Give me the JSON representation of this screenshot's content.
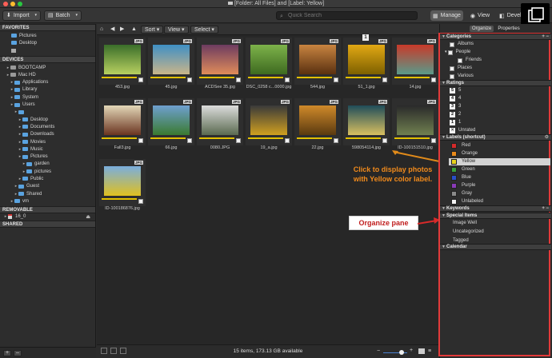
{
  "window": {
    "title": "[Folder: All Files] and [Label: Yellow]"
  },
  "toolbar": {
    "import_label": "Import",
    "batch_label": "Batch",
    "search_placeholder": "Quick Search",
    "modes": [
      {
        "label": "Manage",
        "active": true
      },
      {
        "label": "View",
        "active": false
      },
      {
        "label": "Develop",
        "active": false
      }
    ]
  },
  "left_panel": {
    "favorites_header": "FAVORITES",
    "favorites": [
      "Pictures",
      "Desktop"
    ],
    "devices_header": "DEVICES",
    "devices": [
      {
        "label": "BOOTCAMP",
        "indent": 1,
        "kind": "drive"
      },
      {
        "label": "Mac HD",
        "indent": 1,
        "kind": "drive"
      },
      {
        "label": "Applications",
        "indent": 2,
        "kind": "folder"
      },
      {
        "label": "Library",
        "indent": 2,
        "kind": "folder"
      },
      {
        "label": "System",
        "indent": 2,
        "kind": "folder"
      },
      {
        "label": "Users",
        "indent": 2,
        "kind": "folder"
      },
      {
        "label": "",
        "indent": 3,
        "kind": "folder"
      },
      {
        "label": "Desktop",
        "indent": 4,
        "kind": "folder"
      },
      {
        "label": "Documents",
        "indent": 4,
        "kind": "folder"
      },
      {
        "label": "Downloads",
        "indent": 4,
        "kind": "folder"
      },
      {
        "label": "Movies",
        "indent": 4,
        "kind": "folder"
      },
      {
        "label": "Music",
        "indent": 4,
        "kind": "folder"
      },
      {
        "label": "Pictures",
        "indent": 4,
        "kind": "folder"
      },
      {
        "label": "garden",
        "indent": 5,
        "kind": "folder"
      },
      {
        "label": "pictures",
        "indent": 5,
        "kind": "folder"
      },
      {
        "label": "Public",
        "indent": 4,
        "kind": "folder"
      },
      {
        "label": "Guest",
        "indent": 3,
        "kind": "folder"
      },
      {
        "label": "Shared",
        "indent": 3,
        "kind": "folder"
      },
      {
        "label": "vm",
        "indent": 2,
        "kind": "folder"
      }
    ],
    "removable_header": "REMOVABLE",
    "removable_item": "16_0",
    "shared_header": "SHARED",
    "add_button": "+",
    "remove_button": "–"
  },
  "browser_nav": {
    "sort_label": "Sort",
    "view_label": "View",
    "select_label": "Select"
  },
  "thumbnails": [
    {
      "name": "453.jpg",
      "badge": "JPG",
      "colors": [
        "#3a6e2a",
        "#b8d060"
      ]
    },
    {
      "name": "45.jpg",
      "badge": "JPG",
      "colors": [
        "#3f8fc4",
        "#c9b58a"
      ]
    },
    {
      "name": "ACDSee 35.jpg",
      "badge": "JPG",
      "colors": [
        "#6d3c60",
        "#e08c5a"
      ]
    },
    {
      "name": "DSC_0258 c...0000.jpg",
      "badge": "JPG",
      "colors": [
        "#7db24a",
        "#3e6a20"
      ]
    },
    {
      "name": "544.jpg",
      "badge": "JPG",
      "colors": [
        "#c88440",
        "#5a3010"
      ]
    },
    {
      "name": "51_1.jpg",
      "badge": "JPG",
      "colors": [
        "#e2a814",
        "#7d6000"
      ]
    },
    {
      "name": "14.jpg",
      "badge": "JPG",
      "colors": [
        "#c83a2a",
        "#5a9a8a"
      ]
    },
    {
      "name": "Fall3.jpg",
      "badge": "JPG",
      "colors": [
        "#e3d8b8",
        "#6a3420"
      ]
    },
    {
      "name": "66.jpg",
      "badge": "JPG",
      "colors": [
        "#6fa0d0",
        "#3a7a30"
      ]
    },
    {
      "name": "0080.JPG",
      "badge": "JPG",
      "colors": [
        "#dcdcdc",
        "#5a6a50"
      ]
    },
    {
      "name": "19_a.jpg",
      "badge": "JPG",
      "colors": [
        "#3a3a3a",
        "#d0a020"
      ]
    },
    {
      "name": "22.jpg",
      "badge": "JPG",
      "colors": [
        "#d08a2a",
        "#5a3a10"
      ]
    },
    {
      "name": "598054114.jpg",
      "badge": "JPG",
      "colors": [
        "#1f4d5a",
        "#d8c060"
      ]
    },
    {
      "name": "ID-100151510.jpg",
      "badge": "JPG",
      "colors": [
        "#2a2a2a",
        "#708050"
      ]
    },
    {
      "name": "ID-100186876.jpg",
      "badge": "JPG",
      "colors": [
        "#7aaede",
        "#e0c020"
      ]
    }
  ],
  "thumb_top_badge": "1",
  "callout_text": "Click to display photos with Yellow color label.",
  "organize_label": "Organize pane",
  "status": {
    "text": "15 items, 173.13 GB available"
  },
  "right_panel": {
    "tab_organize": "Organize",
    "tab_properties": "Properties",
    "categories_header": "Categories",
    "categories": [
      {
        "label": "Albums",
        "indent": 0
      },
      {
        "label": "People",
        "indent": 0
      },
      {
        "label": "Friends",
        "indent": 1
      },
      {
        "label": "Places",
        "indent": 0
      },
      {
        "label": "Various",
        "indent": 0
      }
    ],
    "ratings_header": "Ratings",
    "ratings": [
      {
        "num": "5",
        "label": "5"
      },
      {
        "num": "4",
        "label": "4"
      },
      {
        "num": "3",
        "label": "3"
      },
      {
        "num": "2",
        "label": "2"
      },
      {
        "num": "1",
        "label": "1"
      },
      {
        "num": "",
        "label": "Unrated"
      }
    ],
    "labels_header": "Labels (shortcut)",
    "labels": [
      {
        "label": "Red",
        "color": "#d42a2a"
      },
      {
        "label": "Orange",
        "color": "#e88a1a"
      },
      {
        "label": "Yellow",
        "color": "#e8d21e"
      },
      {
        "label": "Green",
        "color": "#3aa03a"
      },
      {
        "label": "Blue",
        "color": "#2a4fc8"
      },
      {
        "label": "Purple",
        "color": "#8a3ab8"
      },
      {
        "label": "Gray",
        "color": "#8a8a8a"
      },
      {
        "label": "Unlabeled",
        "color": "#f2f2f2"
      }
    ],
    "keywords_header": "Keywords",
    "special_header": "Special Items",
    "special_items": [
      "Image Well",
      "Uncategorized",
      "Tagged"
    ],
    "calendar_header": "Calendar"
  },
  "colors": {
    "accent": "#e23a3a",
    "callout": "#f08a1c",
    "yellow_label": "#e2c000"
  }
}
